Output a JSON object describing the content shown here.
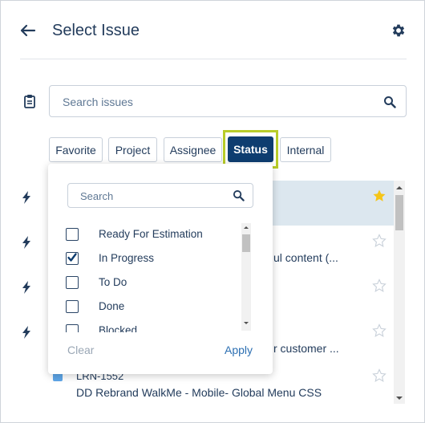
{
  "header": {
    "title": "Select Issue",
    "back_icon": "arrow-left-icon",
    "settings_icon": "gear-icon"
  },
  "search": {
    "placeholder": "Search issues",
    "value": ""
  },
  "filters": {
    "chips": [
      "Favorite",
      "Project",
      "Assignee",
      "Status",
      "Internal"
    ],
    "active": "Status",
    "highlight_color": "#b8cc2a",
    "active_color": "#0e3d70"
  },
  "status_dropdown": {
    "search_placeholder": "Search",
    "options": [
      {
        "label": "Ready For Estimation",
        "checked": false
      },
      {
        "label": "In Progress",
        "checked": true
      },
      {
        "label": "To Do",
        "checked": false
      },
      {
        "label": "Done",
        "checked": false
      },
      {
        "label": "Blocked",
        "checked": false
      }
    ],
    "clear_label": "Clear",
    "apply_label": "Apply"
  },
  "issues": [
    {
      "type": "bolt-icon",
      "visible_text": "",
      "favorite": true
    },
    {
      "type": "bolt-icon",
      "visible_text": "ul content (...",
      "favorite": false
    },
    {
      "type": "bolt-icon",
      "visible_text": "",
      "favorite": false
    },
    {
      "type": "bolt-icon",
      "visible_text": "r customer ...",
      "favorite": false
    },
    {
      "type": "story-icon",
      "key": "LRN-1552",
      "visible_text": "DD Rebrand WalkMe - Mobile- Global Menu CSS",
      "favorite": false
    }
  ],
  "colors": {
    "star_active": "#f5c518",
    "star_inactive": "#c9d1da",
    "selected_row": "#dce7ef"
  }
}
